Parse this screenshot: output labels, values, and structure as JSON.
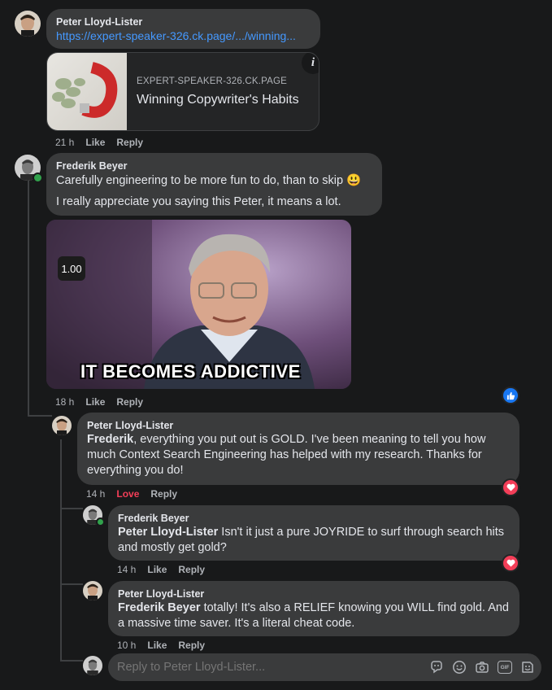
{
  "comments": [
    {
      "author": "Peter Lloyd-Lister",
      "link": "https://expert-speaker-326.ck.page/.../winning...",
      "preview": {
        "domain": "EXPERT-SPEAKER-326.CK.PAGE",
        "title": "Winning Copywriter's Habits",
        "info_icon": "i"
      },
      "time": "21 h",
      "like": "Like",
      "reply": "Reply"
    },
    {
      "author": "Frederik Beyer",
      "line1": "Carefully engineering to be more fun to do, than to skip 😃",
      "line2": "I really appreciate you saying this Peter, it means a lot.",
      "gif": {
        "badge": "1.00",
        "caption": "IT BECOMES ADDICTIVE"
      },
      "time": "18 h",
      "like": "Like",
      "reply": "Reply",
      "reaction": "like-icon"
    },
    {
      "author": "Peter Lloyd-Lister",
      "mention": "Frederik",
      "line1_rest": ", everything you put out is GOLD. I've been meaning to tell you how",
      "line2": "much Context Search Engineering has helped with my research. Thanks for",
      "line3": "everything you do!",
      "time": "14 h",
      "like": "Love",
      "reply": "Reply",
      "reaction": "heart-icon"
    },
    {
      "author": "Frederik Beyer",
      "mention": "Peter Lloyd-Lister",
      "line1_rest": " Isn't it just a pure JOYRIDE to surf through search hits",
      "line2": "and mostly get gold?",
      "time": "14 h",
      "like": "Like",
      "reply": "Reply",
      "reaction": "heart-icon"
    },
    {
      "author": "Peter Lloyd-Lister",
      "mention": "Frederik Beyer",
      "line1_rest": " totally! It's also a RELIEF knowing you WILL find gold. And",
      "line2": "a massive time saver. It's a literal cheat code.",
      "time": "10 h",
      "like": "Like",
      "reply": "Reply"
    }
  ],
  "reply_box": {
    "placeholder": "Reply to Peter Lloyd-Lister...",
    "icons": [
      "sticker-icon",
      "emoji-icon",
      "camera-icon",
      "gif-icon",
      "avatar-sticker-icon"
    ],
    "gif_label": "GIF"
  },
  "colors": {
    "background": "#18191a",
    "bubble": "#3a3b3c",
    "link": "#4599ff",
    "love": "#f33e58",
    "like_blue": "#1877f2"
  }
}
